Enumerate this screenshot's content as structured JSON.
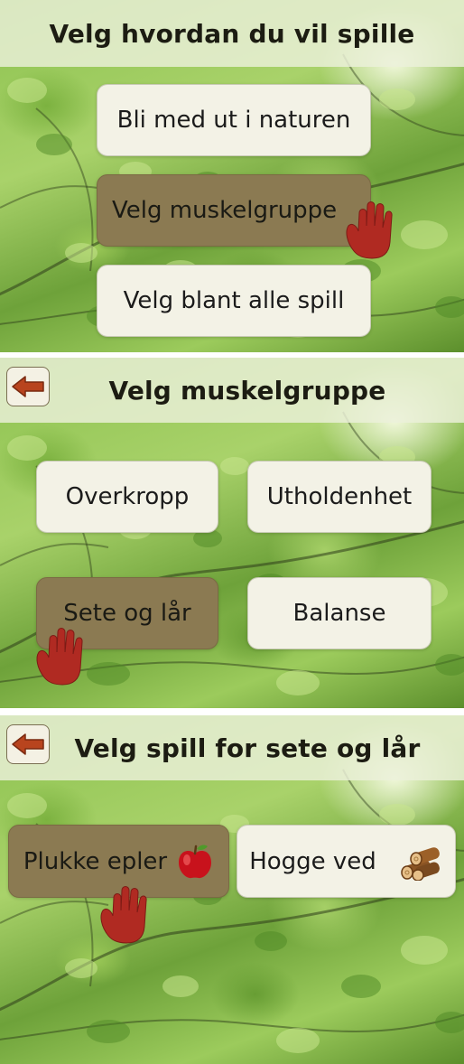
{
  "screen1": {
    "title": "Velg hvordan du vil spille",
    "buttons": [
      {
        "label": "Bli med ut i naturen",
        "selected": false
      },
      {
        "label": "Velg muskelgruppe",
        "selected": true
      },
      {
        "label": "Velg blant alle spill",
        "selected": false
      }
    ]
  },
  "screen2": {
    "title": "Velg muskelgruppe",
    "buttons": [
      {
        "label": "Overkropp",
        "selected": false
      },
      {
        "label": "Utholdenhet",
        "selected": false
      },
      {
        "label": "Sete og lår",
        "selected": true
      },
      {
        "label": "Balanse",
        "selected": false
      }
    ]
  },
  "screen3": {
    "title": "Velg spill for sete og lår",
    "buttons": [
      {
        "label": "Plukke epler",
        "icon": "apple-icon",
        "selected": true
      },
      {
        "label": "Hogge ved",
        "icon": "firewood-icon",
        "selected": false
      }
    ]
  },
  "icons": {
    "back": "back-arrow-icon",
    "pointer": "red-hand-icon"
  },
  "colors": {
    "selected_button": "#8b7a52",
    "button": "#f3f2e6",
    "title_bar": "#ecf0da",
    "hand": "#b02a22",
    "back_arrow": "#b8441e"
  }
}
